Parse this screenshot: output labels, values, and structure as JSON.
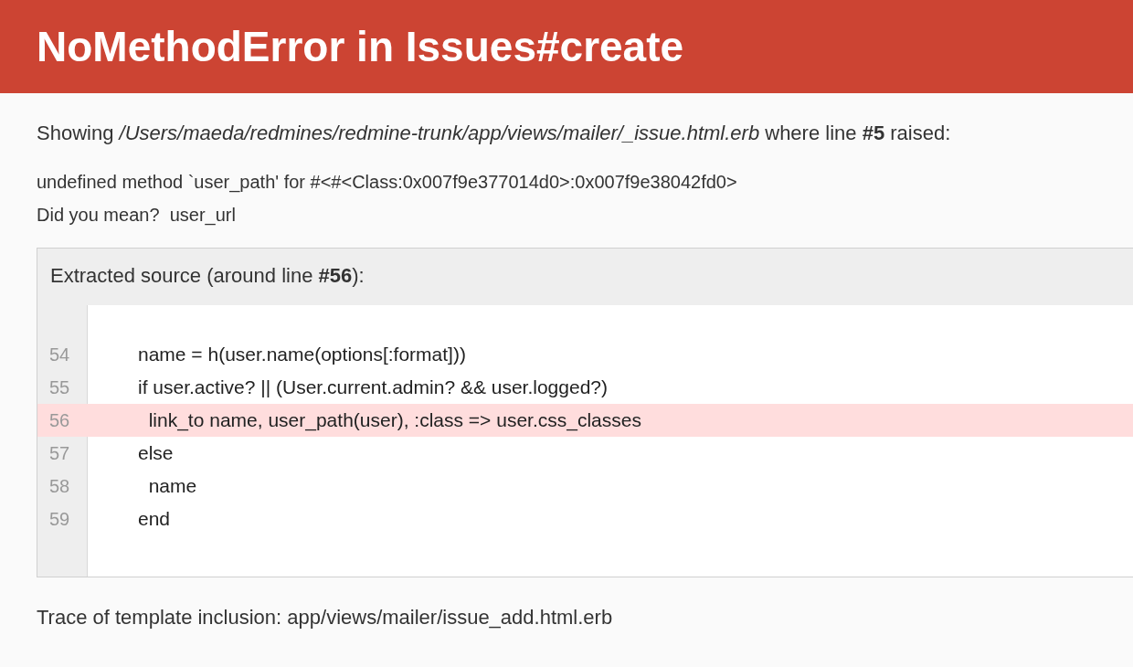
{
  "header": {
    "title": "NoMethodError in Issues#create"
  },
  "summary": "Showing */Users/maeda/redmines/redmine-trunk/app/views/mailer/_issue.html.erb* where line **#5** raised:",
  "message_lines": [
    "undefined method `user_path' for #<#<Class:0x007f9e377014d0>:0x007f9e38042fd0>",
    "Did you mean?  user_url"
  ],
  "source": {
    "heading": "Extracted source (around line **#56**):",
    "lines": [
      {
        "number": "54",
        "code": "      name = h(user.name(options[:format]))",
        "highlighted": false
      },
      {
        "number": "55",
        "code": "      if user.active? || (User.current.admin? && user.logged?)",
        "highlighted": false
      },
      {
        "number": "56",
        "code": "        link_to name, user_path(user), :class => user.css_classes",
        "highlighted": true
      },
      {
        "number": "57",
        "code": "      else",
        "highlighted": false
      },
      {
        "number": "58",
        "code": "        name",
        "highlighted": false
      },
      {
        "number": "59",
        "code": "      end",
        "highlighted": false
      }
    ]
  },
  "trace": "Trace of template inclusion: app/views/mailer/issue_add.html.erb"
}
